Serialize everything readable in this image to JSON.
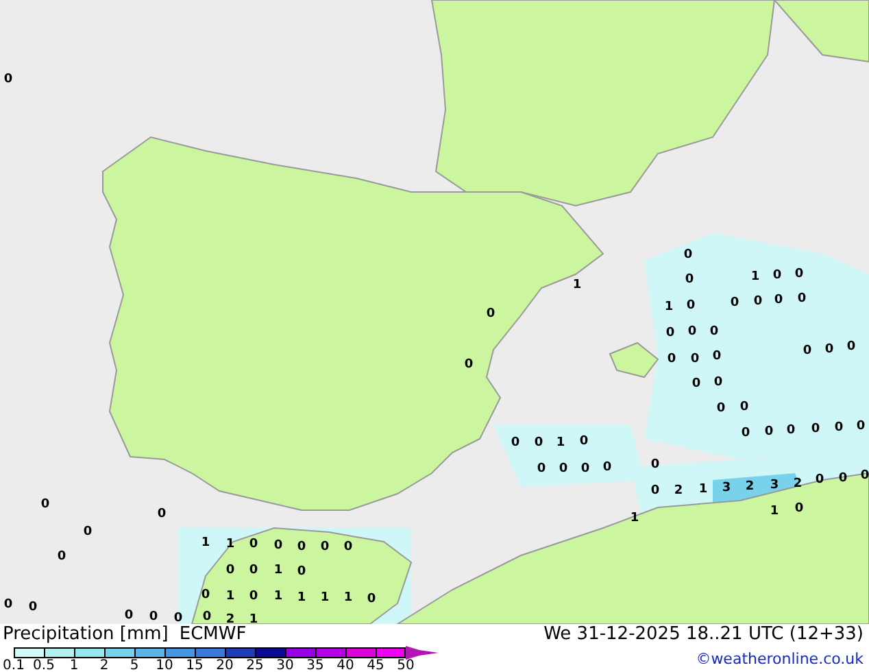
{
  "map": {
    "value_labels": [
      "0",
      "0",
      "0",
      "1",
      "0",
      "1",
      "0",
      "0",
      "0",
      "1",
      "0",
      "0",
      "0",
      "0",
      "0",
      "0",
      "0",
      "0",
      "0",
      "0",
      "0",
      "0",
      "0",
      "0",
      "0",
      "0",
      "0",
      "0",
      "0",
      "0",
      "0",
      "0",
      "0",
      "0",
      "0",
      "0",
      "1",
      "0",
      "0",
      "0",
      "0",
      "0",
      "0",
      "0",
      "2",
      "1",
      "3",
      "2",
      "3",
      "2",
      "0",
      "0",
      "0",
      "1",
      "1",
      "0",
      "0",
      "0",
      "0",
      "0",
      "1",
      "1",
      "0",
      "0",
      "0",
      "0",
      "0",
      "0",
      "0",
      "1",
      "0",
      "0",
      "1",
      "0",
      "1",
      "1",
      "1",
      "1",
      "0",
      "0",
      "0",
      "0",
      "0",
      "0",
      "0",
      "2",
      "1"
    ]
  },
  "legend": {
    "title": "Precipitation [mm]",
    "model": "ECMWF",
    "bins": [
      {
        "kind": "box",
        "color": "#d2fafa"
      },
      {
        "kind": "box",
        "color": "#b4f0f0"
      },
      {
        "kind": "box",
        "color": "#96e6f0"
      },
      {
        "kind": "box",
        "color": "#78d2eb"
      },
      {
        "kind": "box",
        "color": "#5ab4e6"
      },
      {
        "kind": "box",
        "color": "#4696e1"
      },
      {
        "kind": "box",
        "color": "#3c78dc"
      },
      {
        "kind": "box",
        "color": "#1e3cb4"
      },
      {
        "kind": "box",
        "color": "#0a0a96"
      },
      {
        "kind": "box",
        "color": "#9600e6"
      },
      {
        "kind": "box",
        "color": "#b400e6"
      },
      {
        "kind": "box",
        "color": "#dc00dc"
      },
      {
        "kind": "box",
        "color": "#f000f0"
      },
      {
        "kind": "arrow",
        "color": "#b414b4"
      }
    ],
    "ticks": [
      "0.1",
      "0.5",
      "1",
      "2",
      "5",
      "10",
      "15",
      "20",
      "25",
      "30",
      "35",
      "40",
      "45",
      "50"
    ]
  },
  "valid_time": "We 31-12-2025 18..21 UTC (12+33)",
  "credit": "©weatheronline.co.uk"
}
